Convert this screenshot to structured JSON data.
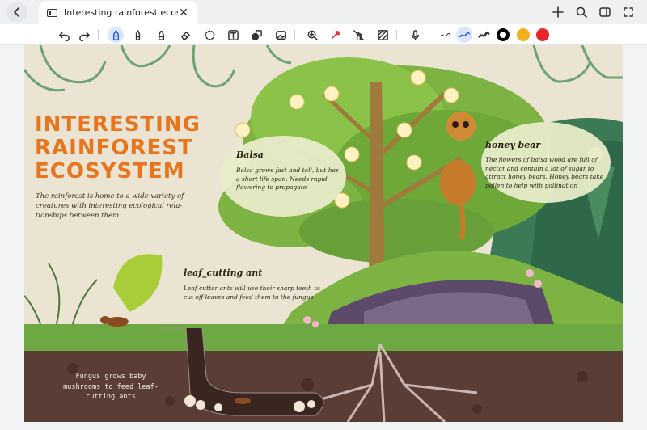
{
  "window": {
    "tab_title": "Interesting rainforest ecosystem"
  },
  "toolbar": {
    "colors": [
      "#000000",
      "#f2b01e",
      "#e8262a"
    ],
    "active_tool": "pen"
  },
  "poster": {
    "title_lines": [
      "INTERESTING",
      "RAINFOREST",
      "ECOSYSTEM"
    ],
    "intro": "The rainforest is home to a wide variety of creatures with interesting ecological rela-tionships between them",
    "balsa": {
      "heading": "Balsa",
      "text": "Balsa grows fast and tall, but has a short life span. Needs rapid flowering to propagate"
    },
    "honey_bear": {
      "heading": "honey bear",
      "text": "The flowers of balsa wood are full of nectar and contain a lot of sugar to attract honey bears. Honey bears take pollen to help with pollination"
    },
    "leaf_ant": {
      "heading": "leaf_cutting ant",
      "text": "Leaf cutter ants will use their sharp teeth to cut off leaves and feed them to the fungus"
    },
    "fungus": "Fungus grows baby mushrooms to feed leaf-cutting ants"
  }
}
